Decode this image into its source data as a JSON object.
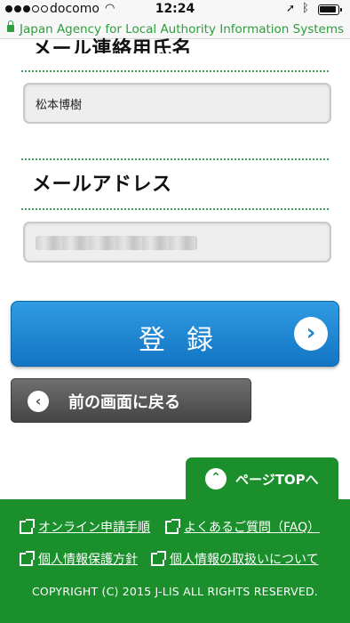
{
  "status_bar": {
    "carrier": "docomo",
    "time": "12:24"
  },
  "browser": {
    "site_title": "Japan Agency for Local Authority Information Systems"
  },
  "form": {
    "name_heading": "メール連絡用氏名",
    "name_value": "松本博樹",
    "email_heading": "メールアドレス",
    "email_value": "",
    "register_label": "登録",
    "register_arrow": "›",
    "back_arrow": "‹",
    "back_label": "前の画面に戻る"
  },
  "page_top": {
    "arrow": "⌃",
    "label": "ページTOPへ"
  },
  "footer": {
    "links": [
      {
        "label": "オンライン申請手順"
      },
      {
        "label": "よくあるご質問（FAQ）"
      },
      {
        "label": "個人情報保護方針"
      },
      {
        "label": "個人情報の取扱いについて"
      }
    ],
    "copyright": "COPYRIGHT (C) 2015 J-LIS ALL RIGHTS RESERVED."
  },
  "colors": {
    "accent_blue": "#1f86d0",
    "footer_green": "#1a8f2c",
    "url_green": "#2e9e3e"
  }
}
